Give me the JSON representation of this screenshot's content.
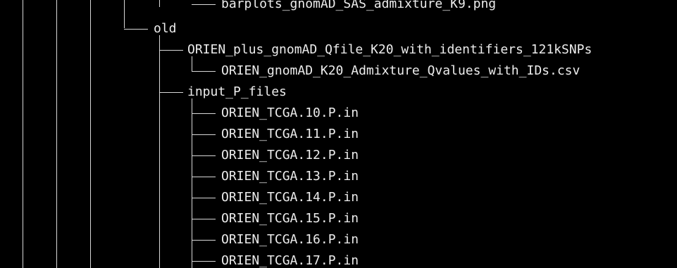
{
  "terminal": {
    "lines": [
      {
        "label": "barplots_gnomAD_SAS_admixture_K9.png"
      },
      {
        "label": "old"
      },
      {
        "label": "ORIEN_plus_gnomAD_Qfile_K20_with_identifiers_121kSNPs"
      },
      {
        "label": "ORIEN_gnomAD_K20_Admixture_Qvalues_with_IDs.csv"
      },
      {
        "label": "input_P_files"
      },
      {
        "label": "ORIEN_TCGA.10.P.in"
      },
      {
        "label": "ORIEN_TCGA.11.P.in"
      },
      {
        "label": "ORIEN_TCGA.12.P.in"
      },
      {
        "label": "ORIEN_TCGA.13.P.in"
      },
      {
        "label": "ORIEN_TCGA.14.P.in"
      },
      {
        "label": "ORIEN_TCGA.15.P.in"
      },
      {
        "label": "ORIEN_TCGA.16.P.in"
      },
      {
        "label": "ORIEN_TCGA.17.P.in"
      }
    ]
  }
}
